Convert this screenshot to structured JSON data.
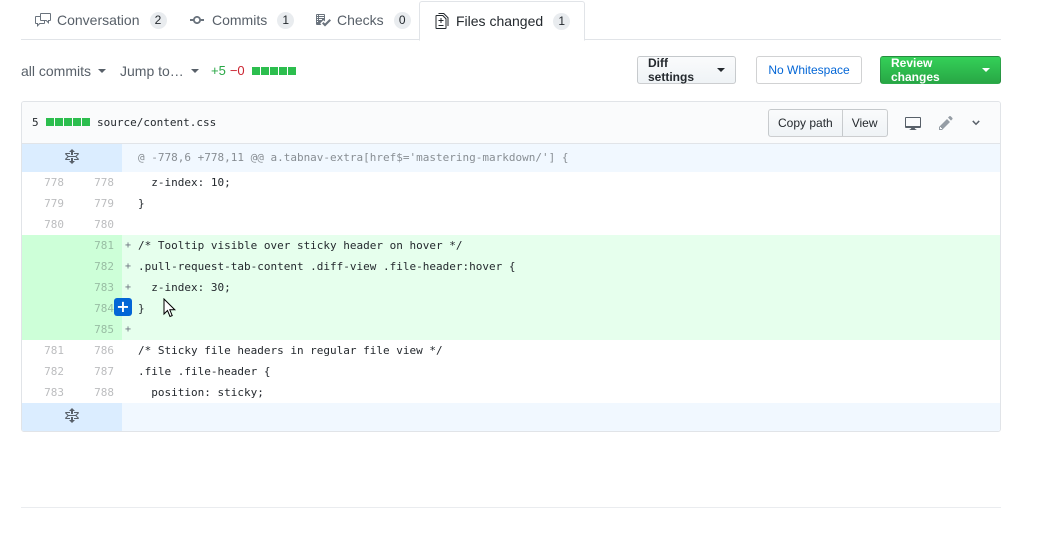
{
  "tabs": [
    {
      "label": "Conversation",
      "count": "2",
      "icon": "comment-discussion-icon"
    },
    {
      "label": "Commits",
      "count": "1",
      "icon": "git-commit-icon"
    },
    {
      "label": "Checks",
      "count": "0",
      "icon": "checklist-icon"
    },
    {
      "label": "Files changed",
      "count": "1",
      "icon": "file-diff-icon",
      "selected": true
    }
  ],
  "toolbar": {
    "all_commits": "all commits",
    "jump_to": "Jump to…",
    "additions": "+5",
    "deletions": "−0",
    "diff_settings": "Diff settings",
    "no_whitespace": "No Whitespace",
    "review_changes": "Review changes"
  },
  "file": {
    "change_count": "5",
    "path": "source/content.css",
    "copy_path": "Copy path",
    "view": "View"
  },
  "diff": {
    "hunk_header": "@ -778,6 +778,11 @@ a.tabnav-extra[href$='mastering-markdown/'] {",
    "lines": [
      {
        "old": "778",
        "new": "778",
        "type": "ctx",
        "marker": "",
        "text": "  z-index: 10;"
      },
      {
        "old": "779",
        "new": "779",
        "type": "ctx",
        "marker": "",
        "text": "}"
      },
      {
        "old": "780",
        "new": "780",
        "type": "ctx",
        "marker": "",
        "text": ""
      },
      {
        "old": "",
        "new": "781",
        "type": "add",
        "marker": "+",
        "text": "/* Tooltip visible over sticky header on hover */"
      },
      {
        "old": "",
        "new": "782",
        "type": "add",
        "marker": "+",
        "text": ".pull-request-tab-content .diff-view .file-header:hover {"
      },
      {
        "old": "",
        "new": "783",
        "type": "add",
        "marker": "+",
        "text": "  z-index: 30;"
      },
      {
        "old": "",
        "new": "784",
        "type": "add",
        "marker": "+",
        "text": "}"
      },
      {
        "old": "",
        "new": "785",
        "type": "add",
        "marker": "+",
        "text": ""
      },
      {
        "old": "781",
        "new": "786",
        "type": "ctx",
        "marker": "",
        "text": "/* Sticky file headers in regular file view */"
      },
      {
        "old": "782",
        "new": "787",
        "type": "ctx",
        "marker": "",
        "text": ".file .file-header {"
      },
      {
        "old": "783",
        "new": "788",
        "type": "ctx",
        "marker": "",
        "text": "  position: sticky;"
      }
    ]
  },
  "colors": {
    "addition_bg": "#e6ffed",
    "addition_gutter": "#cdffd8",
    "hunk_bg": "#f1f8ff",
    "hunk_gutter": "#dbedff",
    "primary_green": "#28a745",
    "link_blue": "#0366d6"
  }
}
